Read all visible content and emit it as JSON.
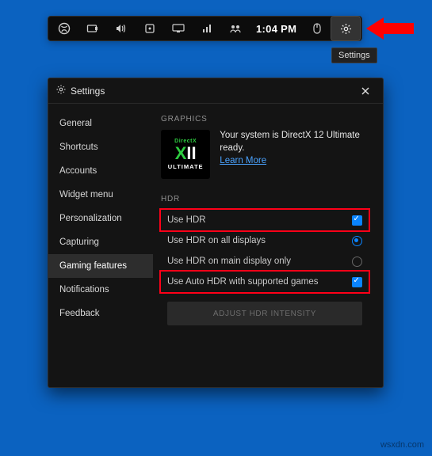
{
  "gamebar": {
    "clock": "1:04 PM",
    "settings_tooltip": "Settings"
  },
  "settings": {
    "title": "Settings",
    "sidebar": {
      "items": [
        {
          "label": "General"
        },
        {
          "label": "Shortcuts"
        },
        {
          "label": "Accounts"
        },
        {
          "label": "Widget menu"
        },
        {
          "label": "Personalization"
        },
        {
          "label": "Capturing"
        },
        {
          "label": "Gaming features",
          "selected": true
        },
        {
          "label": "Notifications"
        },
        {
          "label": "Feedback"
        }
      ]
    },
    "graphics": {
      "section": "GRAPHICS",
      "badge_top": "DirectX",
      "badge_mid_a": "X",
      "badge_mid_b": "II",
      "badge_bot": "ULTIMATE",
      "message": "Your system is DirectX 12 Ultimate ready.",
      "learn_more": "Learn More"
    },
    "hdr": {
      "section": "HDR",
      "use_hdr": "Use HDR",
      "use_hdr_all": "Use HDR on all displays",
      "use_hdr_main": "Use HDR on main display only",
      "auto_hdr": "Use Auto HDR with supported games",
      "adjust": "ADJUST HDR INTENSITY"
    }
  },
  "watermark": "wsxdn.com"
}
